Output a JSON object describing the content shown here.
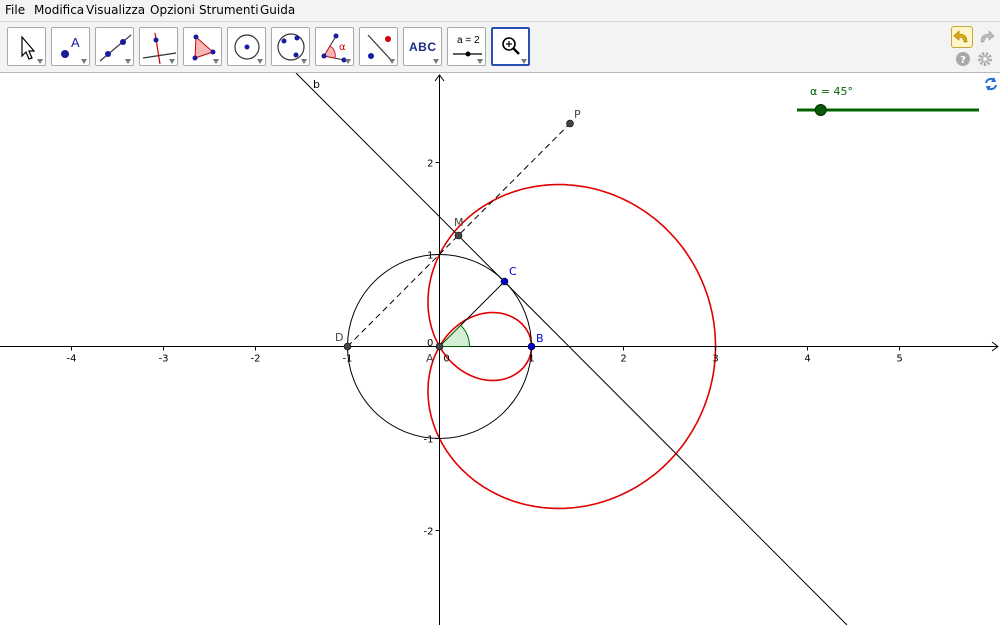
{
  "menu": [
    "File",
    "Modifica",
    "Visualizza",
    "Opzioni",
    "Strumenti",
    "Guida"
  ],
  "toolbar": {
    "tools": [
      "move",
      "point",
      "line",
      "perpendicular",
      "polygon",
      "circle",
      "conic",
      "angle",
      "reflect",
      "text",
      "slider",
      "zoom"
    ],
    "text_tool_label": "ABC",
    "slider_tool_label": "a = 2",
    "undo": "undo-icon",
    "redo": "redo-icon",
    "help": "help-icon",
    "settings": "gear-icon",
    "refresh": "refresh-icon"
  },
  "graphics": {
    "x_ticks": [
      "-4",
      "-3",
      "-2",
      "-1",
      "0",
      "1",
      "2",
      "3",
      "4",
      "5"
    ],
    "y_ticks": [
      "2",
      "1",
      "-1",
      "-2"
    ],
    "points": {
      "A": "A",
      "B": "B",
      "C": "C",
      "D": "D",
      "M": "M",
      "P": "P"
    },
    "origin_label": "0",
    "line_label": "b",
    "slider": {
      "label": "α = 45°",
      "value_deg": 45,
      "position": 0.13
    },
    "colors": {
      "curve": "#e00000",
      "slider": "#006400",
      "points_blue": "#0000cc",
      "points_dark": "#444444"
    }
  }
}
